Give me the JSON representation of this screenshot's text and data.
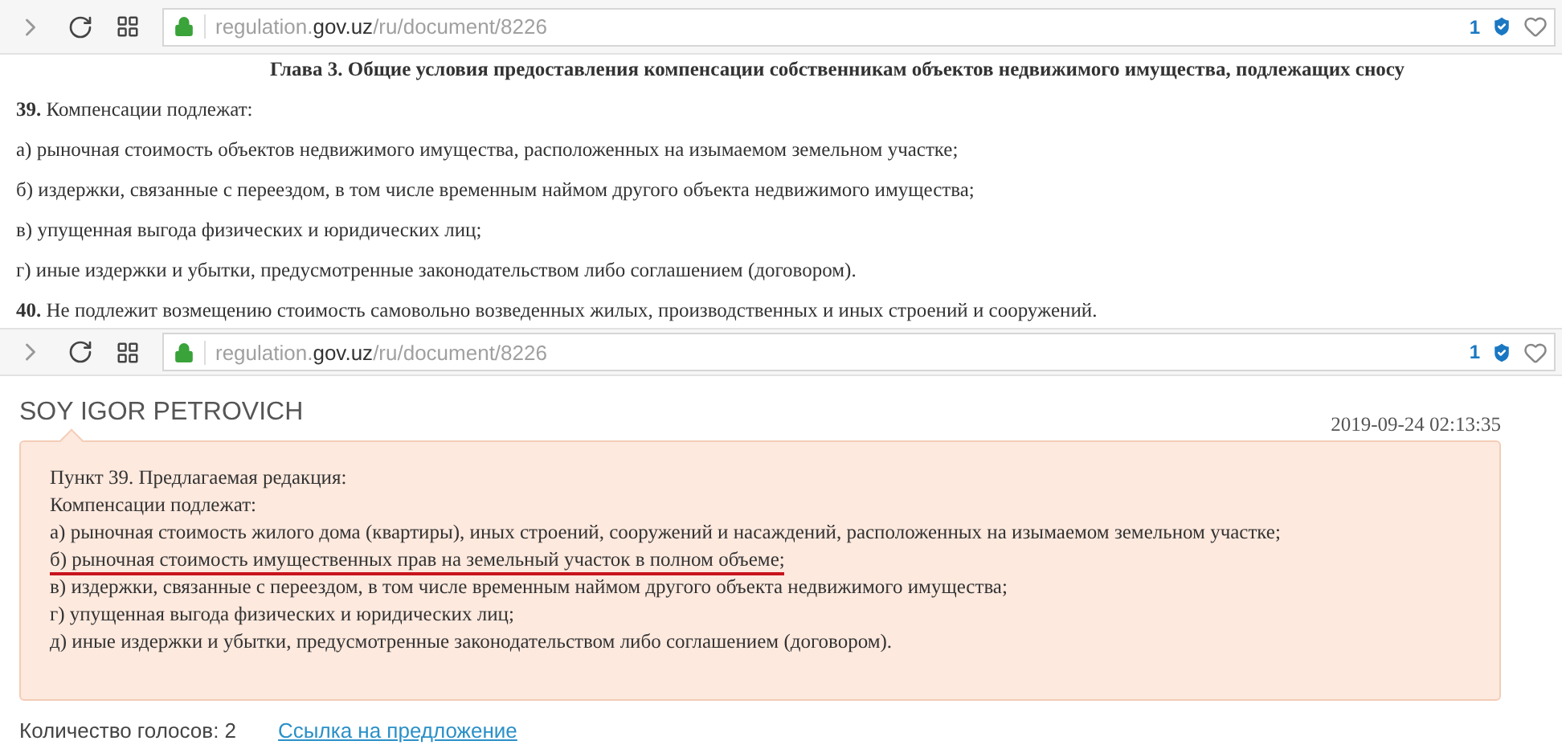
{
  "browser_bars": [
    {
      "url": {
        "subdomain": "regulation.",
        "domain": "gov.uz",
        "path": "/ru/document/8226"
      },
      "badge_count": "1"
    },
    {
      "url": {
        "subdomain": "regulation.",
        "domain": "gov.uz",
        "path": "/ru/document/8226"
      },
      "badge_count": "1"
    }
  ],
  "document": {
    "heading": "Глава 3. Общие условия предоставления компенсации собственникам объектов недвижимого имущества, подлежащих сносу",
    "paragraphs": [
      "**39.** Компенсации подлежат:",
      "а) рыночная стоимость объектов недвижимого имущества, расположенных на изымаемом земельном участке;",
      "б) издержки, связанные с переездом, в том числе временным наймом другого объекта недвижимого имущества;",
      "в) упущенная выгода физических и юридических лиц;",
      "г) иные издержки и убытки, предусмотренные законодательством либо соглашением (договором).",
      "**40.** Не подлежит возмещению стоимость самовольно возведенных жилых, производственных и иных строений и сооружений."
    ]
  },
  "comment": {
    "author": "SOY IGOR PETROVICH",
    "timestamp": "2019-09-24 02:13:35",
    "lines": [
      {
        "text": "Пункт 39. Предлагаемая редакция:",
        "underlined": false
      },
      {
        "text": "Компенсации подлежат:",
        "underlined": false
      },
      {
        "text": "а) рыночная стоимость жилого дома (квартиры), иных строений, сооружений и насаждений, расположенных на изымаемом земельном участке;",
        "underlined": false
      },
      {
        "text": "б) рыночная стоимость имущественных прав на земельный участок в полном объеме;",
        "underlined": true
      },
      {
        "text": "в) издержки, связанные с переездом, в том числе временным наймом другого объекта недвижимого имущества;",
        "underlined": false
      },
      {
        "text": "г) упущенная выгода физических и юридических лиц;",
        "underlined": false
      },
      {
        "text": "д) иные издержки и убытки, предусмотренные законодательством либо соглашением (договором).",
        "underlined": false
      }
    ],
    "votes": "Количество голосов: 2",
    "link": "Ссылка на предложение"
  }
}
